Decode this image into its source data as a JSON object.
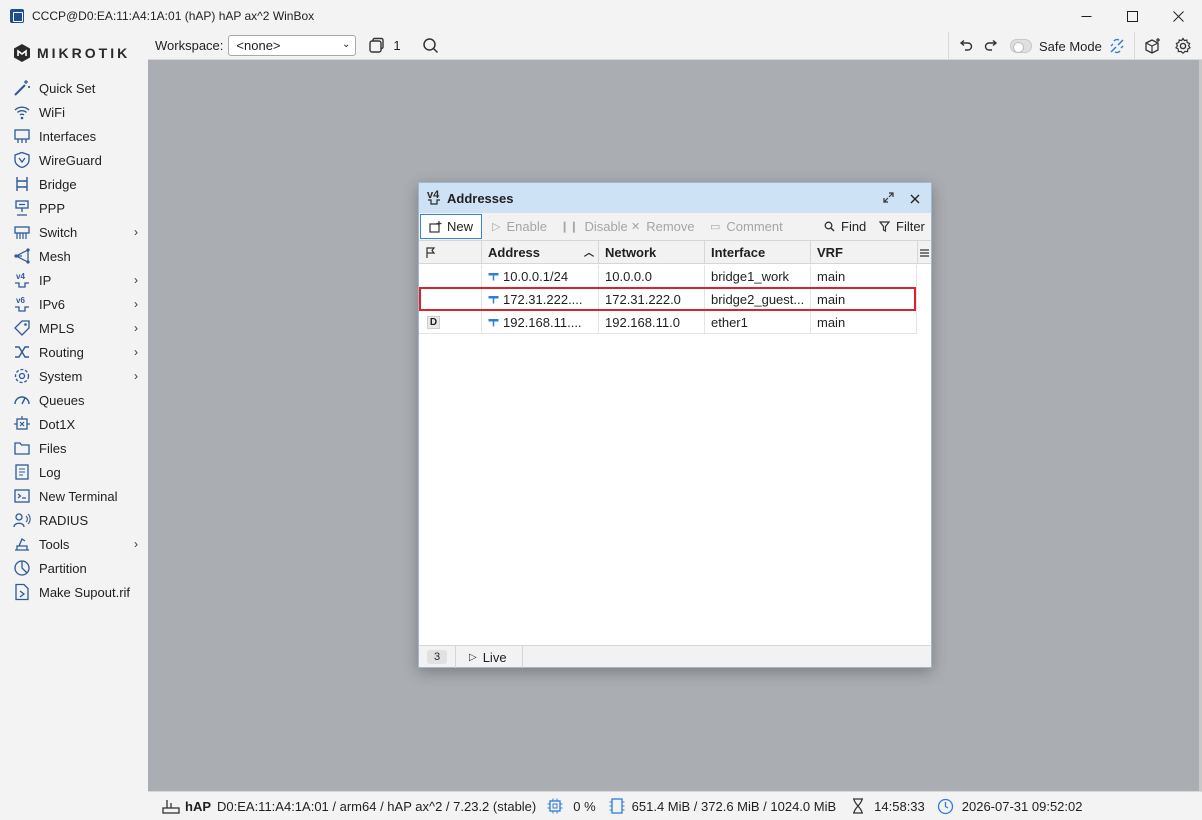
{
  "window": {
    "title": "CCCP@D0:EA:11:A4:1A:01 (hAP) hAP ax^2 WinBox",
    "minimize": "—",
    "maximize": "☐",
    "close": "✕"
  },
  "brand": {
    "logo_text": "MIKROTIK"
  },
  "sidebar": {
    "items": [
      {
        "label": "Quick Set",
        "icon": "magic-wand-icon",
        "submenu": false
      },
      {
        "label": "WiFi",
        "icon": "wifi-icon",
        "submenu": false
      },
      {
        "label": "Interfaces",
        "icon": "interfaces-icon",
        "submenu": false
      },
      {
        "label": "WireGuard",
        "icon": "wireguard-icon",
        "submenu": false
      },
      {
        "label": "Bridge",
        "icon": "bridge-icon",
        "submenu": false
      },
      {
        "label": "PPP",
        "icon": "ppp-icon",
        "submenu": false
      },
      {
        "label": "Switch",
        "icon": "switch-icon",
        "submenu": true
      },
      {
        "label": "Mesh",
        "icon": "mesh-icon",
        "submenu": false
      },
      {
        "label": "IP",
        "icon": "ip-icon",
        "submenu": true
      },
      {
        "label": "IPv6",
        "icon": "ipv6-icon",
        "submenu": true
      },
      {
        "label": "MPLS",
        "icon": "mpls-icon",
        "submenu": true
      },
      {
        "label": "Routing",
        "icon": "routing-icon",
        "submenu": true
      },
      {
        "label": "System",
        "icon": "system-gear-icon",
        "submenu": true
      },
      {
        "label": "Queues",
        "icon": "queues-gauge-icon",
        "submenu": false
      },
      {
        "label": "Dot1X",
        "icon": "dot1x-icon",
        "submenu": false
      },
      {
        "label": "Files",
        "icon": "files-icon",
        "submenu": false
      },
      {
        "label": "Log",
        "icon": "log-icon",
        "submenu": false
      },
      {
        "label": "New Terminal",
        "icon": "terminal-icon",
        "submenu": false
      },
      {
        "label": "RADIUS",
        "icon": "radius-icon",
        "submenu": false
      },
      {
        "label": "Tools",
        "icon": "tools-icon",
        "submenu": true
      },
      {
        "label": "Partition",
        "icon": "partition-icon",
        "submenu": false
      },
      {
        "label": "Make Supout.rif",
        "icon": "supout-file-icon",
        "submenu": false
      }
    ]
  },
  "toolbar": {
    "workspace_label": "Workspace:",
    "workspace_value": "<none>",
    "window_count": "1",
    "safe_mode_label": "Safe Mode",
    "safe_mode_on": false
  },
  "addresses_window": {
    "title": "Addresses",
    "title_icon_text": "v4",
    "buttons": {
      "new": "New",
      "enable": "Enable",
      "disable": "Disable",
      "remove": "Remove",
      "comment": "Comment",
      "find": "Find",
      "filter": "Filter"
    },
    "columns": [
      "Address",
      "Network",
      "Interface",
      "VRF"
    ],
    "sort_indicator": "^",
    "rows": [
      {
        "flag": "",
        "address": "10.0.0.1/24",
        "network": "10.0.0.0",
        "interface": "bridge1_work",
        "vrf": "main"
      },
      {
        "flag": "",
        "address": "172.31.222....",
        "network": "172.31.222.0",
        "interface": "bridge2_guest...",
        "vrf": "main",
        "highlighted": true
      },
      {
        "flag": "D",
        "address": "192.168.11....",
        "network": "192.168.11.0",
        "interface": "ether1",
        "vrf": "main"
      }
    ],
    "footer": {
      "count": "3",
      "live_label": "Live"
    }
  },
  "statusbar": {
    "device": "hAP",
    "details": "D0:EA:11:A4:1A:01 / arm64 / hAP ax^2 / 7.23.2 (stable)",
    "cpu": "0 %",
    "memory": "651.4 MiB / 372.6 MiB / 1024.0 MiB",
    "uptime": "14:58:33",
    "datetime": "2026-07-31 09:52:02"
  },
  "colors": {
    "accent": "#3c84d8",
    "window_title_bg": "#cde3f5",
    "highlight_border": "#d9232b",
    "workspace_bg": "#aaadb1"
  }
}
